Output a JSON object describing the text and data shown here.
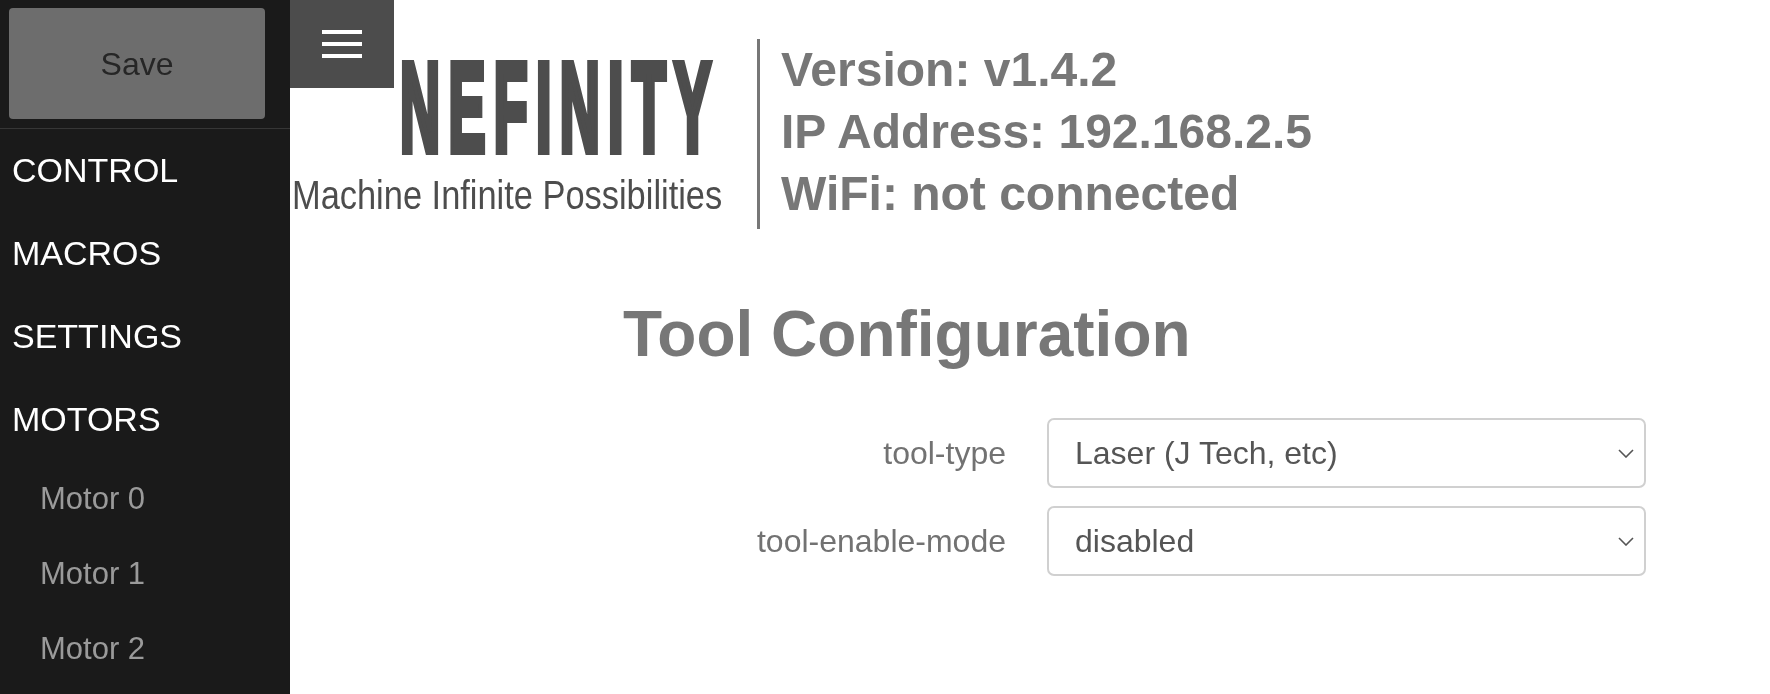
{
  "sidebar": {
    "save_button": "Save",
    "menu": [
      {
        "label": "CONTROL"
      },
      {
        "label": "MACROS"
      },
      {
        "label": "SETTINGS"
      },
      {
        "label": "MOTORS",
        "children": [
          {
            "label": "Motor 0"
          },
          {
            "label": "Motor 1"
          },
          {
            "label": "Motor 2"
          }
        ]
      }
    ]
  },
  "header": {
    "logo": {
      "wordmark": "NEFINITY",
      "tagline": "Machine Infinite Possibilities"
    },
    "info": [
      "Version: v1.4.2",
      "IP Address: 192.168.2.5",
      "WiFi: not connected"
    ]
  },
  "page": {
    "title": "Tool Configuration",
    "fields": [
      {
        "label": "tool-type",
        "value": "Laser (J Tech, etc)"
      },
      {
        "label": "tool-enable-mode",
        "value": "disabled"
      }
    ]
  }
}
